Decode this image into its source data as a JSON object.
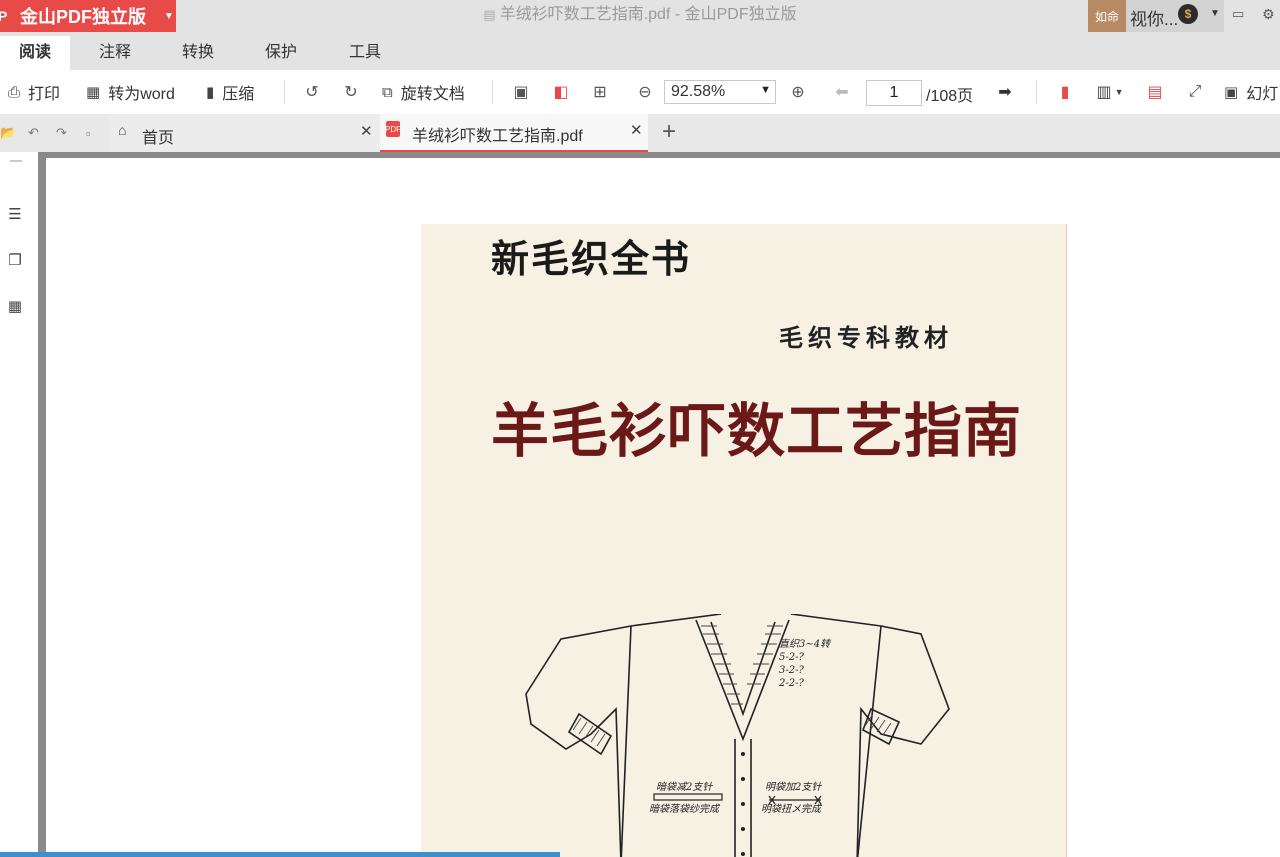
{
  "app": {
    "logo_letter": "P",
    "name": "金山PDF独立版",
    "window_title": "羊绒衫吓数工艺指南.pdf - 金山PDF独立版",
    "user_tag": "如命",
    "user_name": "视你...",
    "coin_symbol": "$"
  },
  "menu_tabs": [
    {
      "label": "阅读",
      "active": true
    },
    {
      "label": "注释"
    },
    {
      "label": "转换"
    },
    {
      "label": "保护"
    },
    {
      "label": "工具"
    }
  ],
  "toolbar": {
    "print_label": "打印",
    "to_word_label": "转为word",
    "compress_label": "压缩",
    "rotate_doc_label": "旋转文档",
    "zoom_value": "92.58%",
    "page_current": "1",
    "page_total": "/108页",
    "slideshow_label": "幻灯"
  },
  "tabs": [
    {
      "label": "首页"
    },
    {
      "label": "羊绒衫吓数工艺指南.pdf",
      "active": true
    }
  ],
  "document": {
    "series_title": "新毛织全书",
    "subtitle": "毛织专科教材",
    "main_title": "羊毛衫吓数工艺指南",
    "illustration_notes": {
      "a": "直织3~4转",
      "b": "5-2-?",
      "c": "3-2-?",
      "d": "2-2-?",
      "e": "暗袋减2支针",
      "f": "暗袋落袋纱完成",
      "g": "明袋加2支针",
      "h": "明袋扭メ完成"
    }
  },
  "colors": {
    "brand_red": "#e84a48",
    "title_dark_red": "#6a1818",
    "page_bg": "#f6f1e3",
    "user_tag_bg": "#b78a63"
  }
}
